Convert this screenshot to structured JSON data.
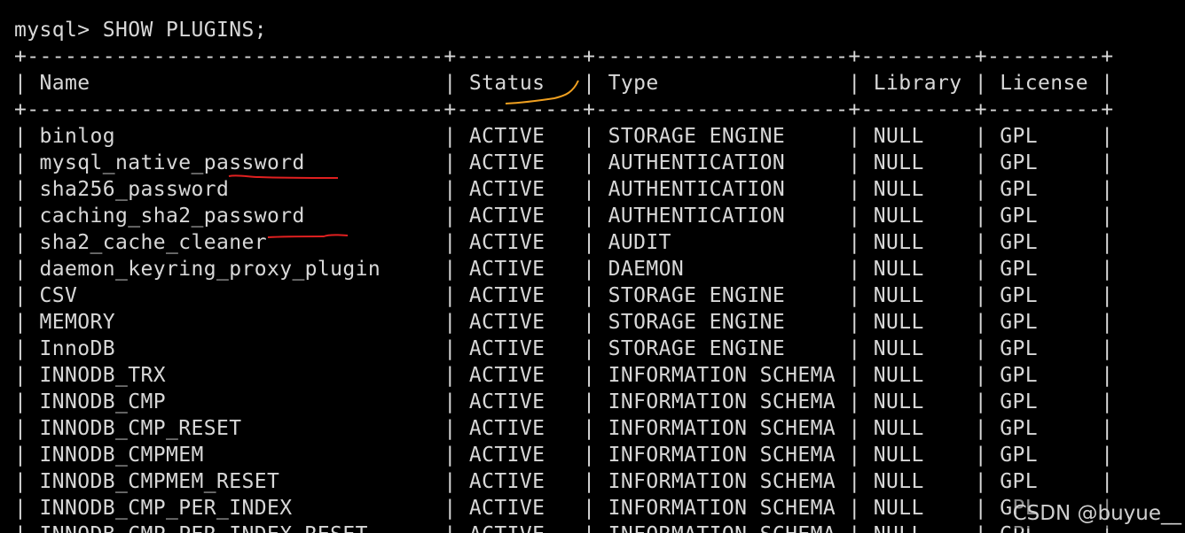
{
  "terminal": {
    "prompt": "mysql> SHOW PLUGINS;",
    "columns": [
      "Name",
      "Status",
      "Type",
      "Library",
      "License"
    ],
    "rows": [
      [
        "binlog",
        "ACTIVE",
        "STORAGE ENGINE",
        "NULL",
        "GPL"
      ],
      [
        "mysql_native_password",
        "ACTIVE",
        "AUTHENTICATION",
        "NULL",
        "GPL"
      ],
      [
        "sha256_password",
        "ACTIVE",
        "AUTHENTICATION",
        "NULL",
        "GPL"
      ],
      [
        "caching_sha2_password",
        "ACTIVE",
        "AUTHENTICATION",
        "NULL",
        "GPL"
      ],
      [
        "sha2_cache_cleaner",
        "ACTIVE",
        "AUDIT",
        "NULL",
        "GPL"
      ],
      [
        "daemon_keyring_proxy_plugin",
        "ACTIVE",
        "DAEMON",
        "NULL",
        "GPL"
      ],
      [
        "CSV",
        "ACTIVE",
        "STORAGE ENGINE",
        "NULL",
        "GPL"
      ],
      [
        "MEMORY",
        "ACTIVE",
        "STORAGE ENGINE",
        "NULL",
        "GPL"
      ],
      [
        "InnoDB",
        "ACTIVE",
        "STORAGE ENGINE",
        "NULL",
        "GPL"
      ],
      [
        "INNODB_TRX",
        "ACTIVE",
        "INFORMATION SCHEMA",
        "NULL",
        "GPL"
      ],
      [
        "INNODB_CMP",
        "ACTIVE",
        "INFORMATION SCHEMA",
        "NULL",
        "GPL"
      ],
      [
        "INNODB_CMP_RESET",
        "ACTIVE",
        "INFORMATION SCHEMA",
        "NULL",
        "GPL"
      ],
      [
        "INNODB_CMPMEM",
        "ACTIVE",
        "INFORMATION SCHEMA",
        "NULL",
        "GPL"
      ],
      [
        "INNODB_CMPMEM_RESET",
        "ACTIVE",
        "INFORMATION SCHEMA",
        "NULL",
        "GPL"
      ],
      [
        "INNODB_CMP_PER_INDEX",
        "ACTIVE",
        "INFORMATION SCHEMA",
        "NULL",
        "GPL"
      ],
      [
        "INNODB_CMP_PER_INDEX_RESET",
        "ACTIVE",
        "INFORMATION SCHEMA",
        "NULL",
        "GPL"
      ]
    ]
  },
  "watermark": "CSDN @buyue__",
  "colors": {
    "background": "#000000",
    "text": "#d8d8d8",
    "annotation_red": "#e02020",
    "annotation_orange": "#f0a020"
  }
}
